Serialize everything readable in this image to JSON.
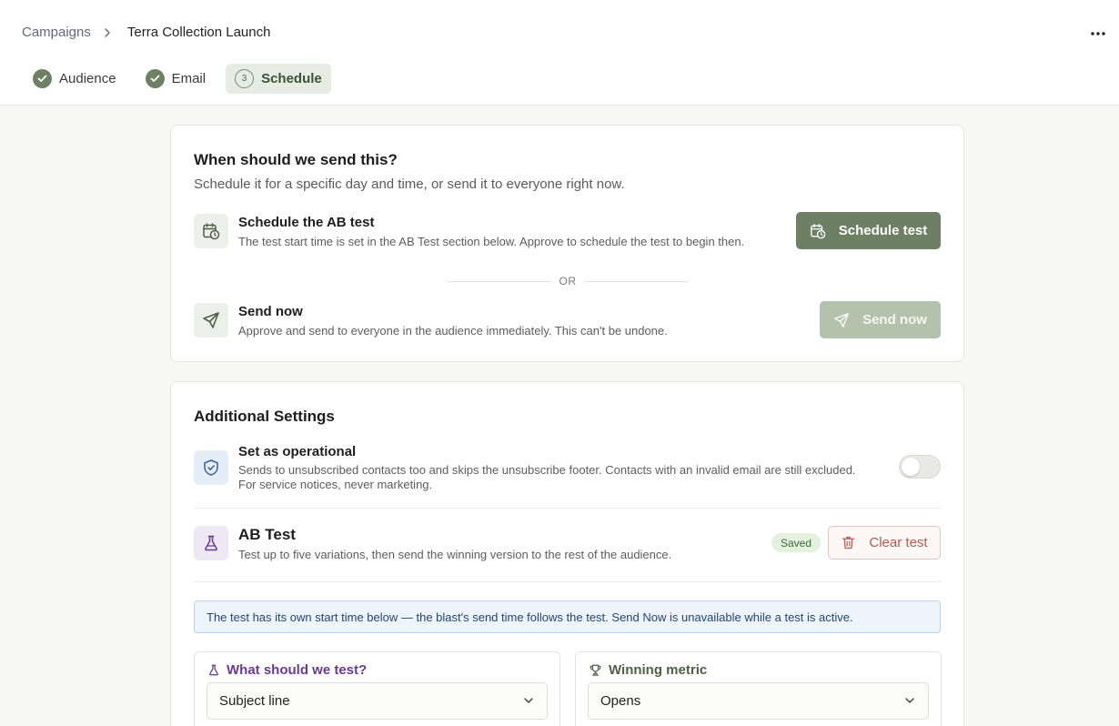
{
  "breadcrumb": {
    "parent": "Campaigns",
    "current": "Terra Collection Launch"
  },
  "steps": [
    {
      "label": "Audience",
      "state": "done"
    },
    {
      "label": "Email",
      "state": "done"
    },
    {
      "number": "3",
      "label": "Schedule",
      "state": "active"
    }
  ],
  "schedule_card": {
    "title": "When should we send this?",
    "subtitle": "Schedule it for a specific day and time, or send it to everyone right now.",
    "schedule_option": {
      "title": "Schedule the AB test",
      "description": "The test start time is set in the AB Test section below. Approve to schedule the test to begin then.",
      "button_label": "Schedule test",
      "icon": "calendar-clock-icon"
    },
    "divider_text": "OR",
    "send_option": {
      "title": "Send now",
      "description": "Approve and send to everyone in the audience immediately. This can't be undone.",
      "button_label": "Send now",
      "button_disabled": true,
      "icon": "send-icon"
    }
  },
  "settings_card": {
    "title": "Additional Settings",
    "operational": {
      "title": "Set as operational",
      "description_line1": "Sends to unsubscribed contacts too and skips the unsubscribe footer. Contacts with an invalid email are still excluded.",
      "description_line2": "For service notices, never marketing.",
      "enabled": false,
      "icon": "shield-check-icon"
    },
    "ab_test": {
      "title": "AB Test",
      "description": "Test up to five variations, then send the winning version to the rest of the audience.",
      "badge": "Saved",
      "clear_label": "Clear test",
      "icon": "flask-icon"
    },
    "notice": "The test has its own start time below — the blast's send time follows the test. Send Now is unavailable while a test is active.",
    "test_variable": {
      "label": "What should we test?",
      "value": "Subject line"
    },
    "winning_metric": {
      "label": "Winning metric",
      "value": "Opens"
    }
  },
  "colors": {
    "primary": "#6e8064",
    "primary_disabled": "#b4c2ad",
    "danger": "#b45a4d",
    "notice_bg": "#eef4fc",
    "purple": "#6a3a91"
  }
}
